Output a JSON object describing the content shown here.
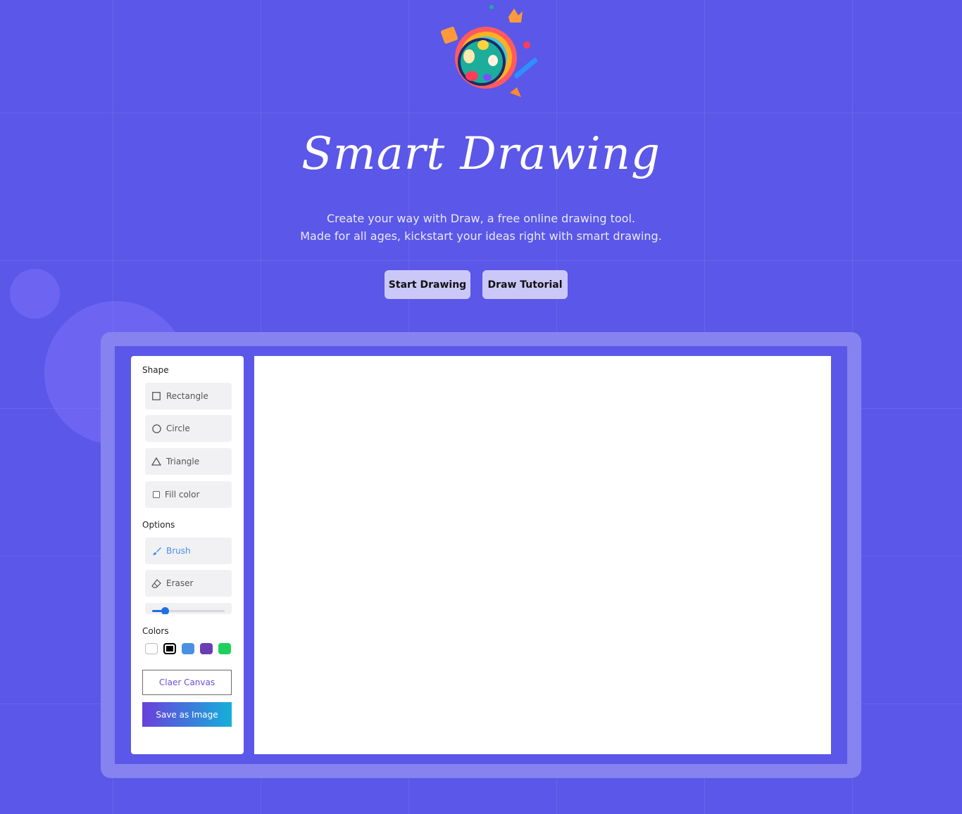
{
  "hero": {
    "title": "Smart Drawing",
    "subtitle_line1": "Create your way with Draw, a free online drawing tool.",
    "subtitle_line2": "Made for all ages, kickstart your ideas right with smart drawing.",
    "start_label": "Start Drawing",
    "tutorial_label": "Draw Tutorial"
  },
  "tools": {
    "shape_label": "Shape",
    "rectangle_label": "Rectangle",
    "circle_label": "Circle",
    "triangle_label": "Triangle",
    "fill_label": "Fill color",
    "options_label": "Options",
    "brush_label": "Brush",
    "eraser_label": "Eraser",
    "size_value": 0.18,
    "colors_label": "Colors",
    "colors": [
      "#ffffff",
      "#000000",
      "#4a90e2",
      "#6a3db5",
      "#1ed15a"
    ],
    "selected_color": "#000000",
    "clear_label": "Claer Canvas",
    "save_label": "Save as Image"
  },
  "icons": {
    "rectangle": "square-outline-icon",
    "circle": "circle-outline-icon",
    "triangle": "triangle-outline-icon",
    "fill": "checkbox-icon",
    "brush": "brush-icon",
    "eraser": "eraser-icon"
  }
}
